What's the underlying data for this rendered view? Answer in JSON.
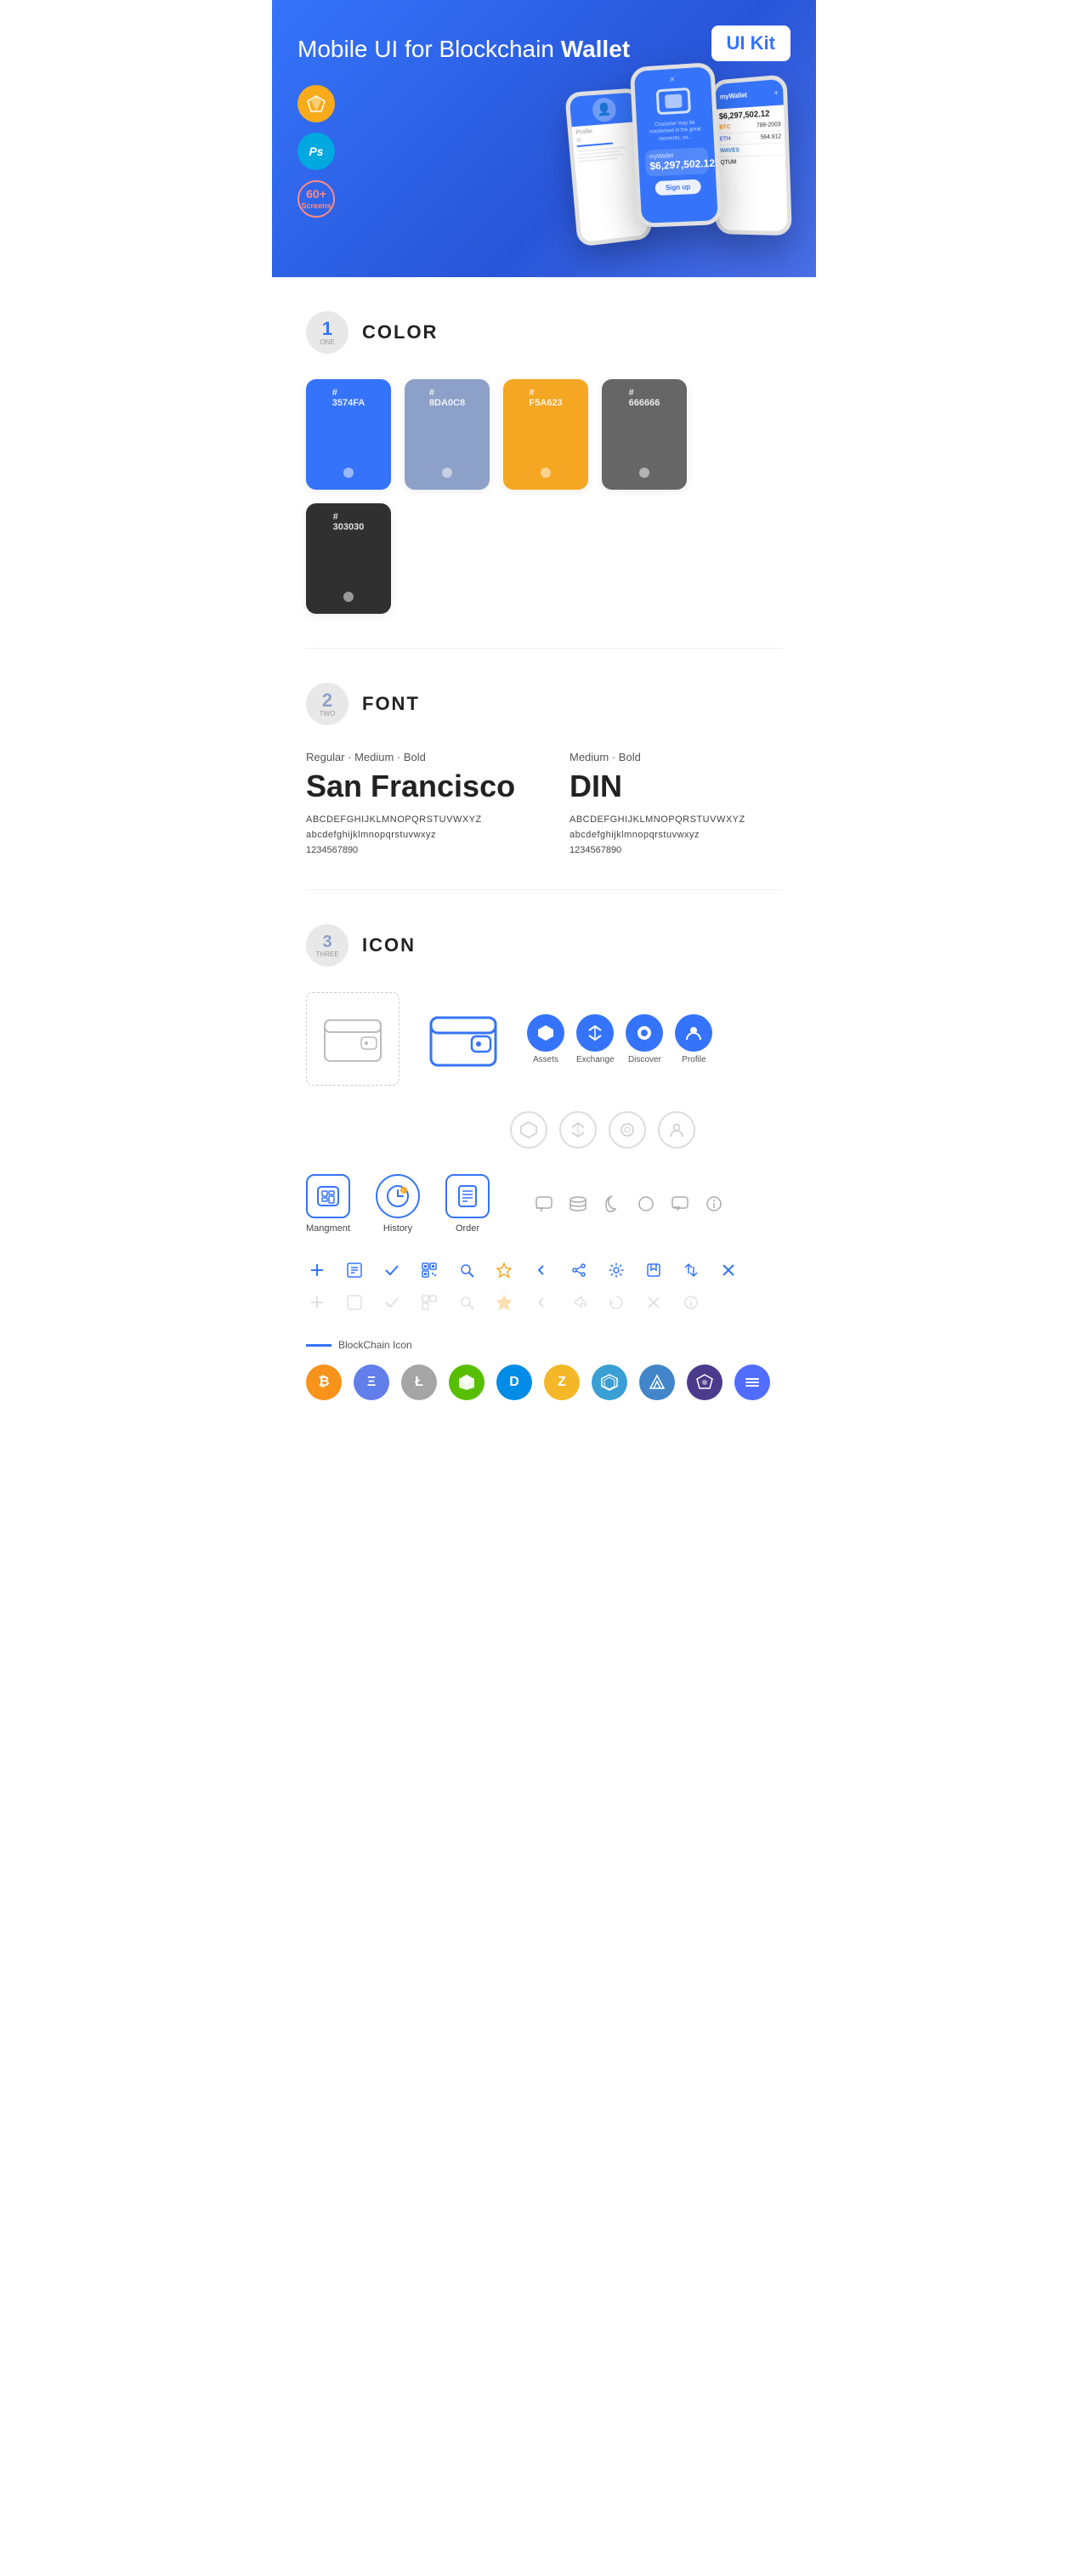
{
  "hero": {
    "title_normal": "Mobile UI for Blockchain ",
    "title_bold": "Wallet",
    "badge": "UI Kit",
    "badges": [
      {
        "id": "sketch",
        "label": "S"
      },
      {
        "id": "ps",
        "label": "Ps"
      },
      {
        "id": "screens",
        "label": "60+\nScreens"
      }
    ]
  },
  "section1": {
    "number": "1",
    "sub": "ONE",
    "title": "COLOR",
    "swatches": [
      {
        "hex": "#3574FA",
        "label": "#\n3574FA",
        "class": "swatch-1"
      },
      {
        "hex": "#8DA0C8",
        "label": "#\n8DA0C8",
        "class": "swatch-2"
      },
      {
        "hex": "#F5A623",
        "label": "#\nF5A623",
        "class": "swatch-3"
      },
      {
        "hex": "#666666",
        "label": "#\n666666",
        "class": "swatch-4"
      },
      {
        "hex": "#303030",
        "label": "#\n303030",
        "class": "swatch-5"
      }
    ]
  },
  "section2": {
    "number": "2",
    "sub": "TWO",
    "title": "FONT",
    "font1": {
      "style": "Regular · Medium · Bold",
      "name": "San Francisco",
      "upper": "ABCDEFGHIJKLMNOPQRSTUVWXYZ",
      "lower": "abcdefghijklmnopqrstuvwxyz",
      "nums": "1234567890"
    },
    "font2": {
      "style": "Medium · Bold",
      "name": "DIN",
      "upper": "ABCDEFGHIJKLMNOPQRSTUVWXYZ",
      "lower": "abcdefghijklmnopqrstuvwxyz",
      "nums": "1234567890"
    }
  },
  "section3": {
    "number": "3",
    "sub": "THREE",
    "title": "ICON",
    "icons_main": [
      {
        "id": "assets",
        "label": "Assets",
        "symbol": "◆"
      },
      {
        "id": "exchange",
        "label": "Exchange",
        "symbol": "♻"
      },
      {
        "id": "discover",
        "label": "Discover",
        "symbol": "●"
      },
      {
        "id": "profile",
        "label": "Profile",
        "symbol": "👤"
      }
    ],
    "mgmt_icons": [
      {
        "id": "management",
        "label": "Mangment",
        "symbol": "⊡"
      },
      {
        "id": "history",
        "label": "History",
        "symbol": "◷"
      },
      {
        "id": "order",
        "label": "Order",
        "symbol": "☰"
      }
    ],
    "misc_icons": [
      "+",
      "⊟",
      "✓",
      "⊞",
      "🔍",
      "☆",
      "‹",
      "≪",
      "⚙",
      "⊡",
      "⇄",
      "✕"
    ],
    "blockchain_label": "BlockChain Icon",
    "cryptos": [
      {
        "id": "btc",
        "label": "₿",
        "class": "crypto-btc"
      },
      {
        "id": "eth",
        "label": "Ξ",
        "class": "crypto-eth"
      },
      {
        "id": "ltc",
        "label": "Ł",
        "class": "crypto-ltc"
      },
      {
        "id": "neo",
        "label": "N",
        "class": "crypto-neo"
      },
      {
        "id": "dash",
        "label": "D",
        "class": "crypto-dash"
      },
      {
        "id": "zcash",
        "label": "Z",
        "class": "crypto-zcash"
      },
      {
        "id": "grid",
        "label": "⬡",
        "class": "crypto-grid"
      },
      {
        "id": "waves",
        "label": "W",
        "class": "crypto-waves"
      },
      {
        "id": "poly",
        "label": "P",
        "class": "crypto-poly"
      },
      {
        "id": "band",
        "label": "B",
        "class": "crypto-band"
      }
    ]
  }
}
